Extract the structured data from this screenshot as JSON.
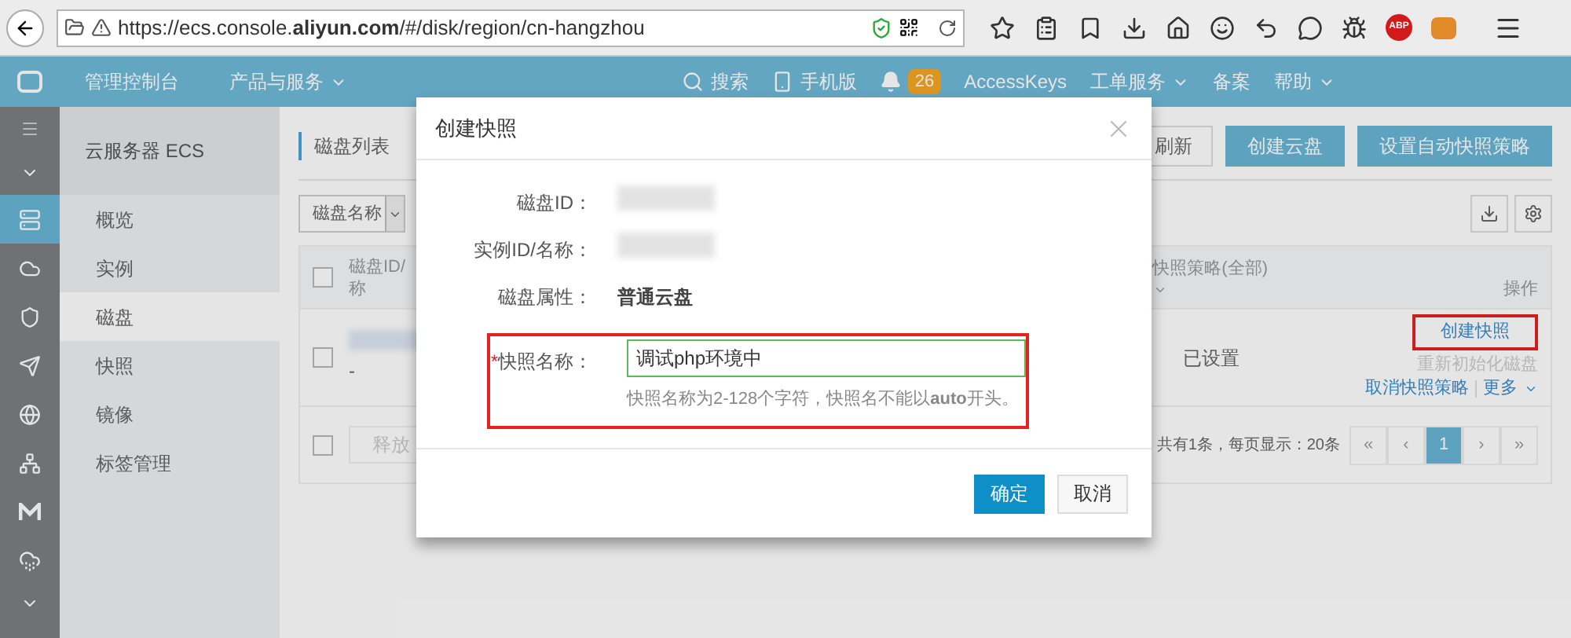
{
  "browser": {
    "url": "https://ecs.console.**aliyun.com**/#/disk/region/cn-hangzhou",
    "addon_badge": "ABP"
  },
  "header": {
    "brand": "管理控制台",
    "products": "产品与服务",
    "links": [
      {
        "label": "搜索",
        "kind": "search"
      },
      {
        "label": "手机版",
        "kind": "phone"
      },
      {
        "label": "26",
        "kind": "bell"
      },
      {
        "label": "AccessKeys",
        "kind": "text"
      },
      {
        "label": "工单服务",
        "kind": "menu"
      },
      {
        "label": "备案",
        "kind": "text"
      },
      {
        "label": "帮助",
        "kind": "menu"
      }
    ]
  },
  "rail": {
    "items": [
      {
        "selected": true
      },
      {
        "selected": false
      },
      {
        "selected": false
      },
      {
        "selected": false
      },
      {
        "selected": false
      },
      {
        "selected": false
      },
      {
        "selected": false
      },
      {
        "selected": false
      }
    ]
  },
  "sidebar": {
    "title": "云服务器 ECS",
    "items": [
      {
        "label": "概览",
        "selected": false
      },
      {
        "label": "实例",
        "selected": false
      },
      {
        "label": "磁盘",
        "selected": true
      },
      {
        "label": "快照",
        "selected": false
      },
      {
        "label": "镜像",
        "selected": false
      },
      {
        "label": "标签管理",
        "selected": false
      }
    ]
  },
  "toolbar": {
    "title": "磁盘列表",
    "buttons": [
      {
        "label": "刷新",
        "kind": "default"
      },
      {
        "label": "创建云盘",
        "kind": "primary"
      },
      {
        "label": "设置自动快照策略",
        "kind": "primary"
      }
    ]
  },
  "filter": {
    "label": "磁盘名称"
  },
  "table": {
    "checkboxes": [
      {
        "checked": false
      },
      {
        "checked": false
      },
      {
        "checked": false
      }
    ],
    "column_1": [
      "磁盘ID/",
      "称"
    ],
    "policy_column": "快照策略(全部)",
    "actions_column": "操作",
    "row": {
      "dash": "-",
      "policy": "已设置",
      "actions": [
        {
          "label": "创建快照",
          "disabled": false,
          "highlighted": true
        },
        {
          "label": "重新初始化磁盘",
          "disabled": true,
          "highlighted": false
        },
        {
          "label": "取消快照策略",
          "disabled": false,
          "highlighted": false
        }
      ],
      "more": "更多"
    },
    "release": "释放",
    "summary": "共有1条，每页显示：20条",
    "pages": [
      {
        "label": "«",
        "selected": false
      },
      {
        "label": "‹",
        "selected": false
      },
      {
        "label": "1",
        "selected": true
      },
      {
        "label": "›",
        "selected": false
      },
      {
        "label": "»",
        "selected": false
      }
    ]
  },
  "dialog": {
    "title": "创建快照",
    "fields": [
      {
        "label": "磁盘ID：",
        "kind": "redacted"
      },
      {
        "label": "实例ID/名称：",
        "kind": "redacted"
      },
      {
        "label": "磁盘属性：",
        "kind": "text",
        "value": "普通云盘"
      },
      {
        "label": "快照名称：",
        "kind": "input",
        "required_mark": "*",
        "value": "调试php环境中",
        "hint": "快照名称为2-128个字符，快照名不能以**auto**开头。"
      }
    ],
    "buttons": [
      {
        "label": "确定",
        "kind": "primary"
      },
      {
        "label": "取消",
        "kind": "default"
      }
    ]
  }
}
